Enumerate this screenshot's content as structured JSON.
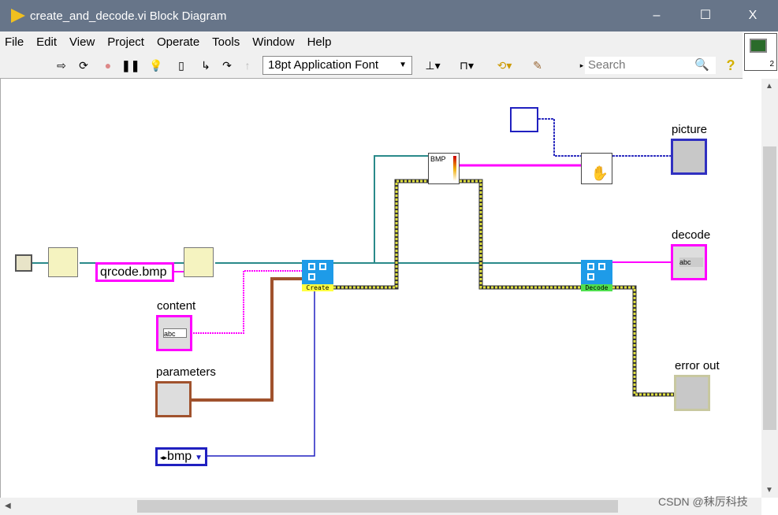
{
  "window": {
    "title": "create_and_decode.vi Block Diagram",
    "minimize": "–",
    "maximize": "☐",
    "close": "X"
  },
  "menu": [
    "File",
    "Edit",
    "View",
    "Project",
    "Operate",
    "Tools",
    "Window",
    "Help"
  ],
  "toolbar": {
    "font": "18pt Application Font",
    "search_placeholder": "Search",
    "help": "?"
  },
  "diagram": {
    "file_constant": "qrcode.bmp",
    "content_label": "content",
    "content_glyph": "abc",
    "parameters_label": "parameters",
    "enum_value": "bmp",
    "create_caption": "Create",
    "decode_caption": "Decode",
    "bmp_node": "BMP",
    "picture_label": "picture",
    "decode_label": "decode",
    "decode_glyph": "abc",
    "error_label": "error out"
  },
  "wire_colors": {
    "path": "#2a8a8a",
    "string": "#ff00ff",
    "cluster": "#a0522d",
    "error": "#c8c800",
    "enum": "#2020c0",
    "picture": "#3030c0"
  },
  "watermark": "CSDN @秣厉科技"
}
